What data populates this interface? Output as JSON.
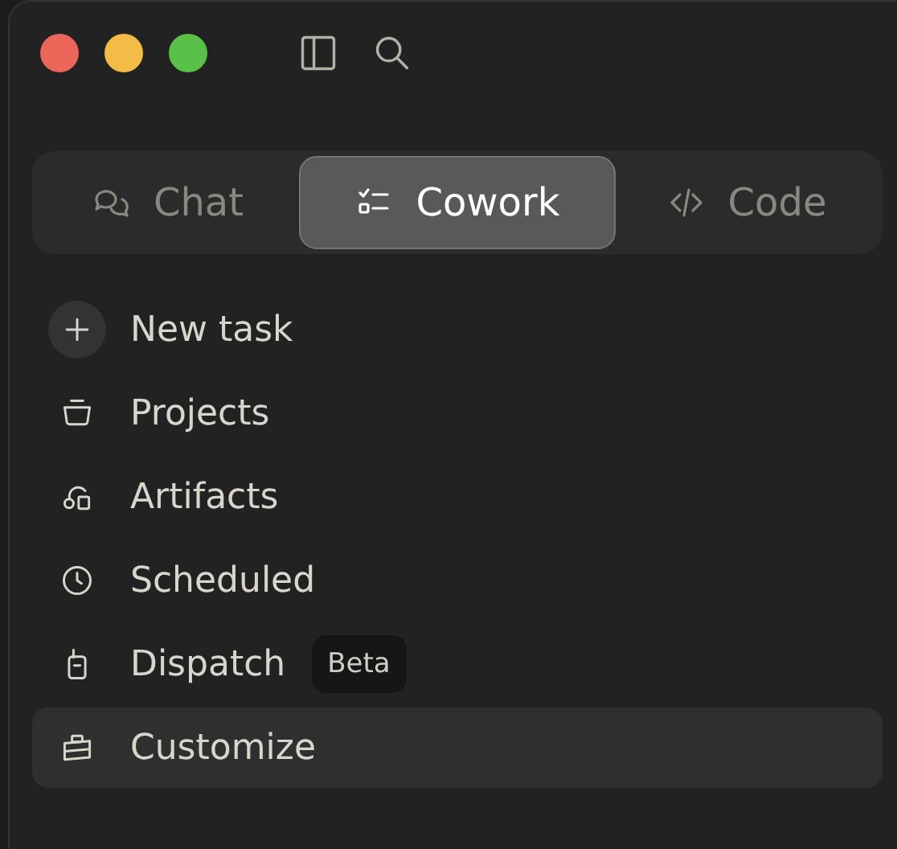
{
  "tabs": [
    {
      "label": "Chat",
      "selected": false
    },
    {
      "label": "Cowork",
      "selected": true
    },
    {
      "label": "Code",
      "selected": false
    }
  ],
  "sidebar": {
    "items": [
      {
        "kind": "action",
        "label": "New task",
        "selected": false
      },
      {
        "kind": "nav",
        "label": "Projects",
        "selected": false
      },
      {
        "kind": "nav",
        "label": "Artifacts",
        "selected": false
      },
      {
        "kind": "nav",
        "label": "Scheduled",
        "selected": false
      },
      {
        "kind": "nav",
        "label": "Dispatch",
        "badge": "Beta",
        "selected": false
      },
      {
        "kind": "nav",
        "label": "Customize",
        "selected": true
      }
    ]
  }
}
